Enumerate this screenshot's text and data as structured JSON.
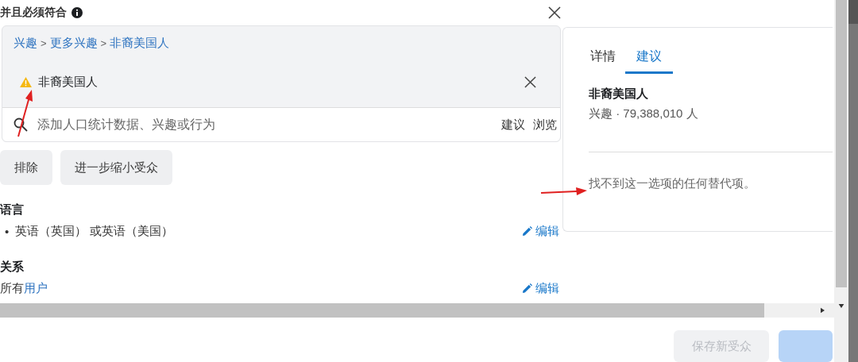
{
  "header": {
    "title": "并且必须符合"
  },
  "breadcrumb": {
    "items": [
      "兴趣",
      "更多兴趣",
      "非裔美国人"
    ],
    "separator": ">"
  },
  "selected_item": {
    "label": "非裔美国人",
    "warning": true
  },
  "search": {
    "placeholder": "添加人口统计数据、兴趣或行为",
    "links": [
      "建议",
      "浏览"
    ]
  },
  "buttons": [
    "排除",
    "进一步缩小受众"
  ],
  "sections": [
    {
      "title": "语言",
      "kind": "bullet",
      "bullet": "•",
      "text": "英语（英国） 或英语（美国）",
      "edit": "编辑"
    },
    {
      "title": "关系",
      "kind": "link",
      "prefix": "所有",
      "link": "用户",
      "edit": "编辑"
    }
  ],
  "panel": {
    "tabs": [
      {
        "label": "详情",
        "selected": false
      },
      {
        "label": "建议",
        "selected": true
      }
    ],
    "name": "非裔美国人",
    "meta": "兴趣 · 79,388,010 人",
    "message": "找不到这一选项的任何替代项。"
  },
  "footer": {
    "buttons": [
      {
        "label": "保存新受众",
        "kind": "secondary"
      },
      {
        "kind": "primary"
      }
    ]
  }
}
